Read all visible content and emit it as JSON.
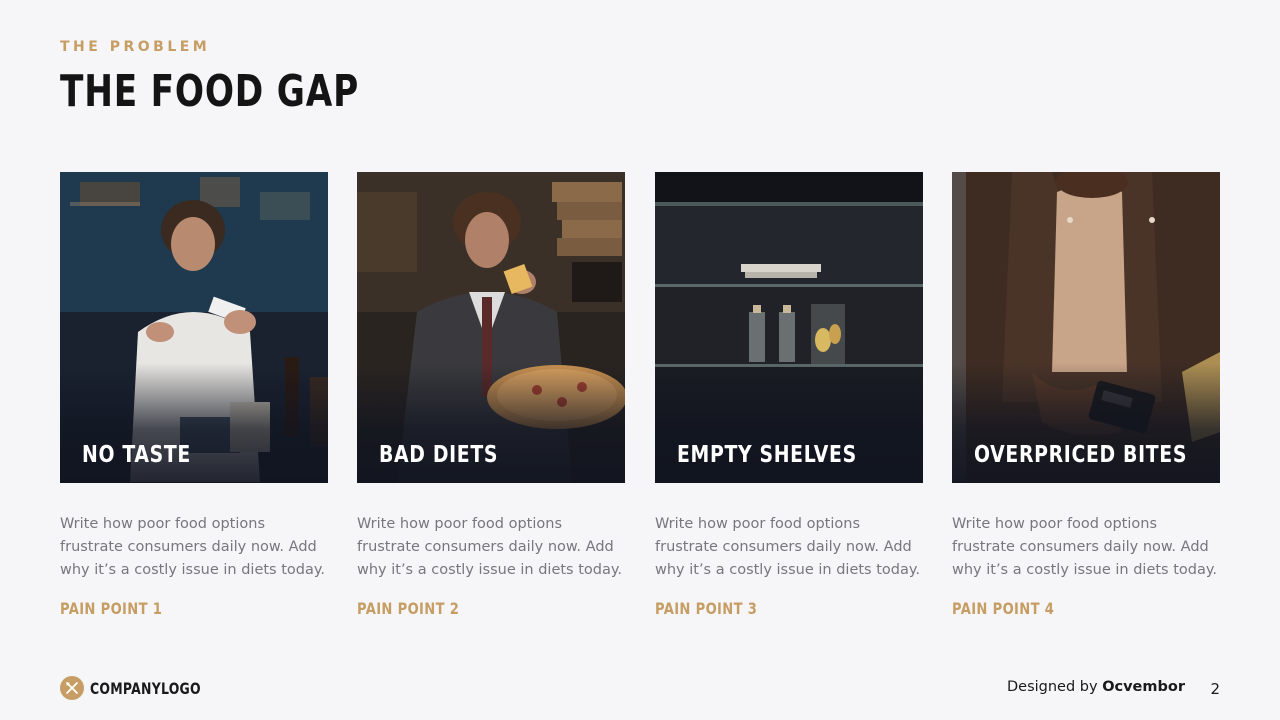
{
  "header": {
    "eyebrow": "THE PROBLEM",
    "title": "THE FOOD GAP"
  },
  "cards": [
    {
      "caption": "NO TASTE",
      "description": "Write how poor food options frustrate consumers daily now. Add why it’s a costly issue in diets today.",
      "label": "PAIN POINT 1",
      "image_icon": "woman-eating-photo"
    },
    {
      "caption": "BAD DIETS",
      "description": "Write how poor food options frustrate consumers daily now. Add why it’s a costly issue in diets today.",
      "label": "PAIN POINT 2",
      "image_icon": "man-eating-pizza-photo"
    },
    {
      "caption": "EMPTY SHELVES",
      "description": "Write how poor food options frustrate consumers daily now. Add why it’s a costly issue in diets today.",
      "label": "PAIN POINT 3",
      "image_icon": "empty-shelf-photo"
    },
    {
      "caption": "OVERPRICED BITES",
      "description": "Write how poor food options frustrate consumers daily now. Add why it’s a costly issue in diets today.",
      "label": "PAIN POINT 4",
      "image_icon": "card-payment-photo"
    }
  ],
  "footer": {
    "logo_text": "COMPANYLOGO",
    "designed_prefix": "Designed by",
    "designed_brand": "Ocvembor",
    "page_number": "2"
  },
  "colors": {
    "background": "#f6f6f9",
    "accent": "#c69e64",
    "title": "#141414",
    "body_text": "#77777c"
  }
}
